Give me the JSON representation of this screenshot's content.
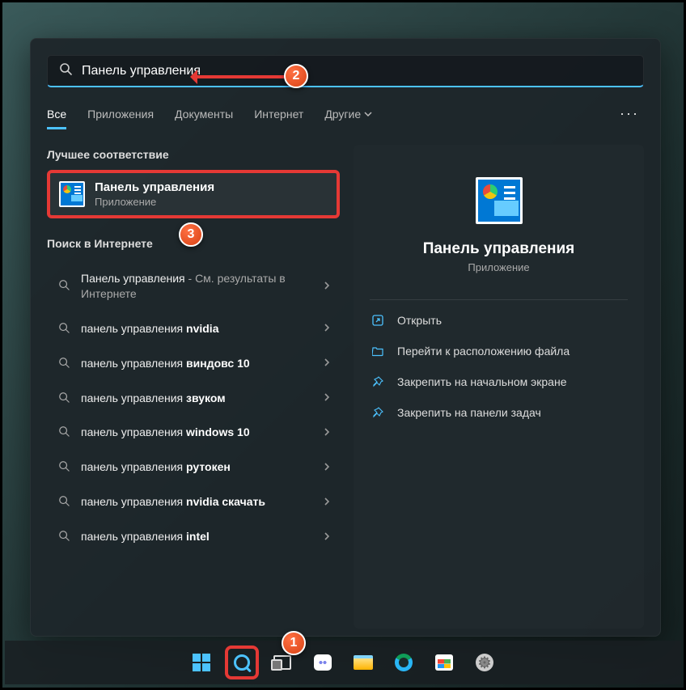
{
  "search": {
    "query": "Панель управления"
  },
  "tabs": {
    "all": "Все",
    "apps": "Приложения",
    "documents": "Документы",
    "web": "Интернет",
    "more": "Другие"
  },
  "sections": {
    "best_match": "Лучшее соответствие",
    "web_search": "Поиск в Интернете"
  },
  "best_match": {
    "title": "Панель управления",
    "subtitle": "Приложение"
  },
  "web_results": [
    {
      "prefix": "Панель управления",
      "suffix": " - См. результаты в Интернете",
      "bold": ""
    },
    {
      "prefix": "панель управления ",
      "suffix": "",
      "bold": "nvidia"
    },
    {
      "prefix": "панель управления ",
      "suffix": "",
      "bold": "виндовс 10"
    },
    {
      "prefix": "панель управления ",
      "suffix": "",
      "bold": "звуком"
    },
    {
      "prefix": "панель управления ",
      "suffix": "",
      "bold": "windows 10"
    },
    {
      "prefix": "панель управления ",
      "suffix": "",
      "bold": "рутокен"
    },
    {
      "prefix": "панель управления ",
      "suffix": "",
      "bold": "nvidia скачать"
    },
    {
      "prefix": "панель управления ",
      "suffix": "",
      "bold": "intel"
    }
  ],
  "preview": {
    "title": "Панель управления",
    "subtitle": "Приложение",
    "actions": {
      "open": "Открыть",
      "location": "Перейти к расположению файла",
      "pin_start": "Закрепить на начальном экране",
      "pin_taskbar": "Закрепить на панели задач"
    }
  },
  "badges": {
    "b1": "1",
    "b2": "2",
    "b3": "3"
  }
}
